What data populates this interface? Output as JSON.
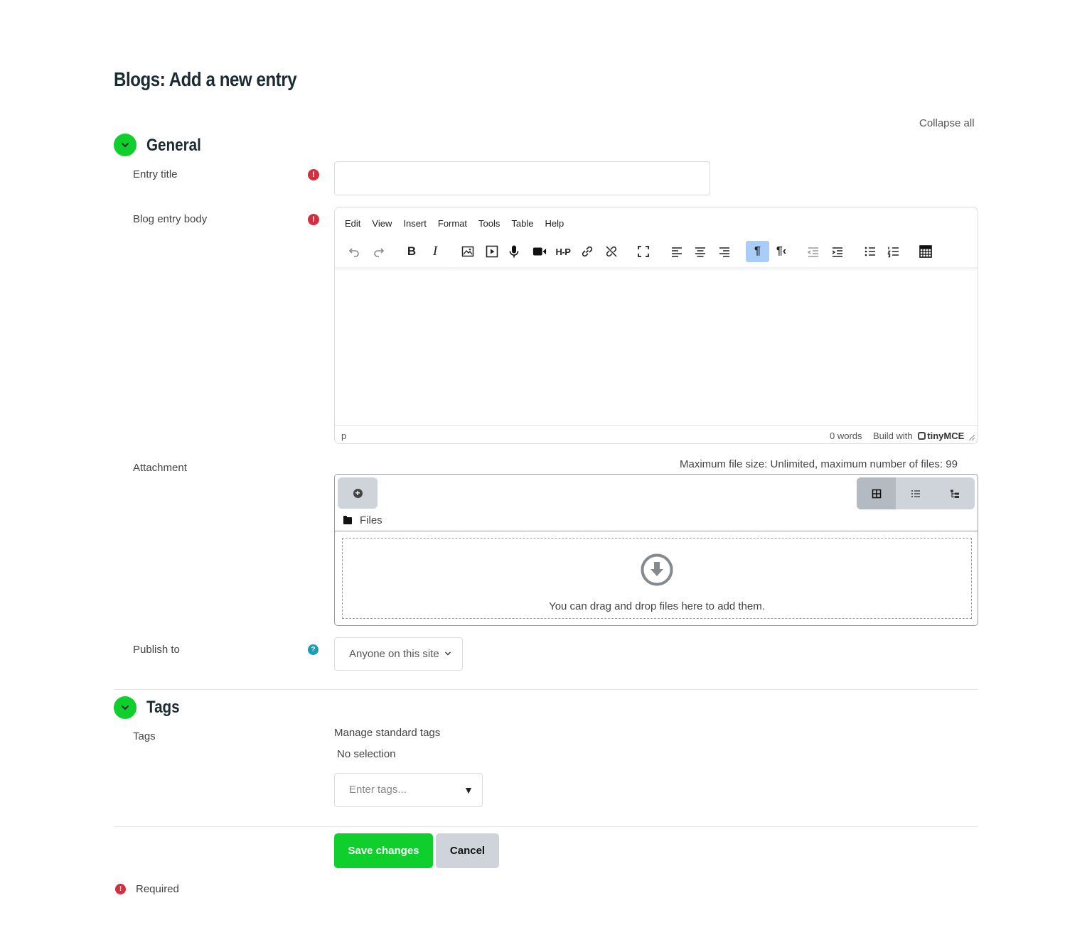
{
  "page": {
    "title": "Blogs: Add a new entry",
    "collapse_all": "Collapse all"
  },
  "sections": {
    "general": {
      "title": "General"
    },
    "tags": {
      "title": "Tags"
    }
  },
  "fields": {
    "entry_title": {
      "label": "Entry title",
      "value": ""
    },
    "body": {
      "label": "Blog entry body"
    },
    "attachment": {
      "label": "Attachment"
    },
    "publish_to": {
      "label": "Publish to",
      "value": "Anyone on this site"
    },
    "tags": {
      "label": "Tags"
    }
  },
  "editor": {
    "menu": [
      "Edit",
      "View",
      "Insert",
      "Format",
      "Tools",
      "Table",
      "Help"
    ],
    "status_path": "p",
    "word_count": "0 words",
    "brand_prefix": "Build with",
    "brand": "tinyMCE"
  },
  "filepicker": {
    "max_size": "Maximum file size: Unlimited, maximum number of files: 99",
    "path": "Files",
    "drop_text": "You can drag and drop files here to add them."
  },
  "tags": {
    "manage": "Manage standard tags",
    "no_selection": "No selection",
    "placeholder": "Enter tags..."
  },
  "buttons": {
    "save": "Save changes",
    "cancel": "Cancel"
  },
  "legend": {
    "required": "Required"
  },
  "colors": {
    "accent": "#0ecf2c",
    "required": "#d32f3e",
    "help": "#1a9bb8"
  }
}
